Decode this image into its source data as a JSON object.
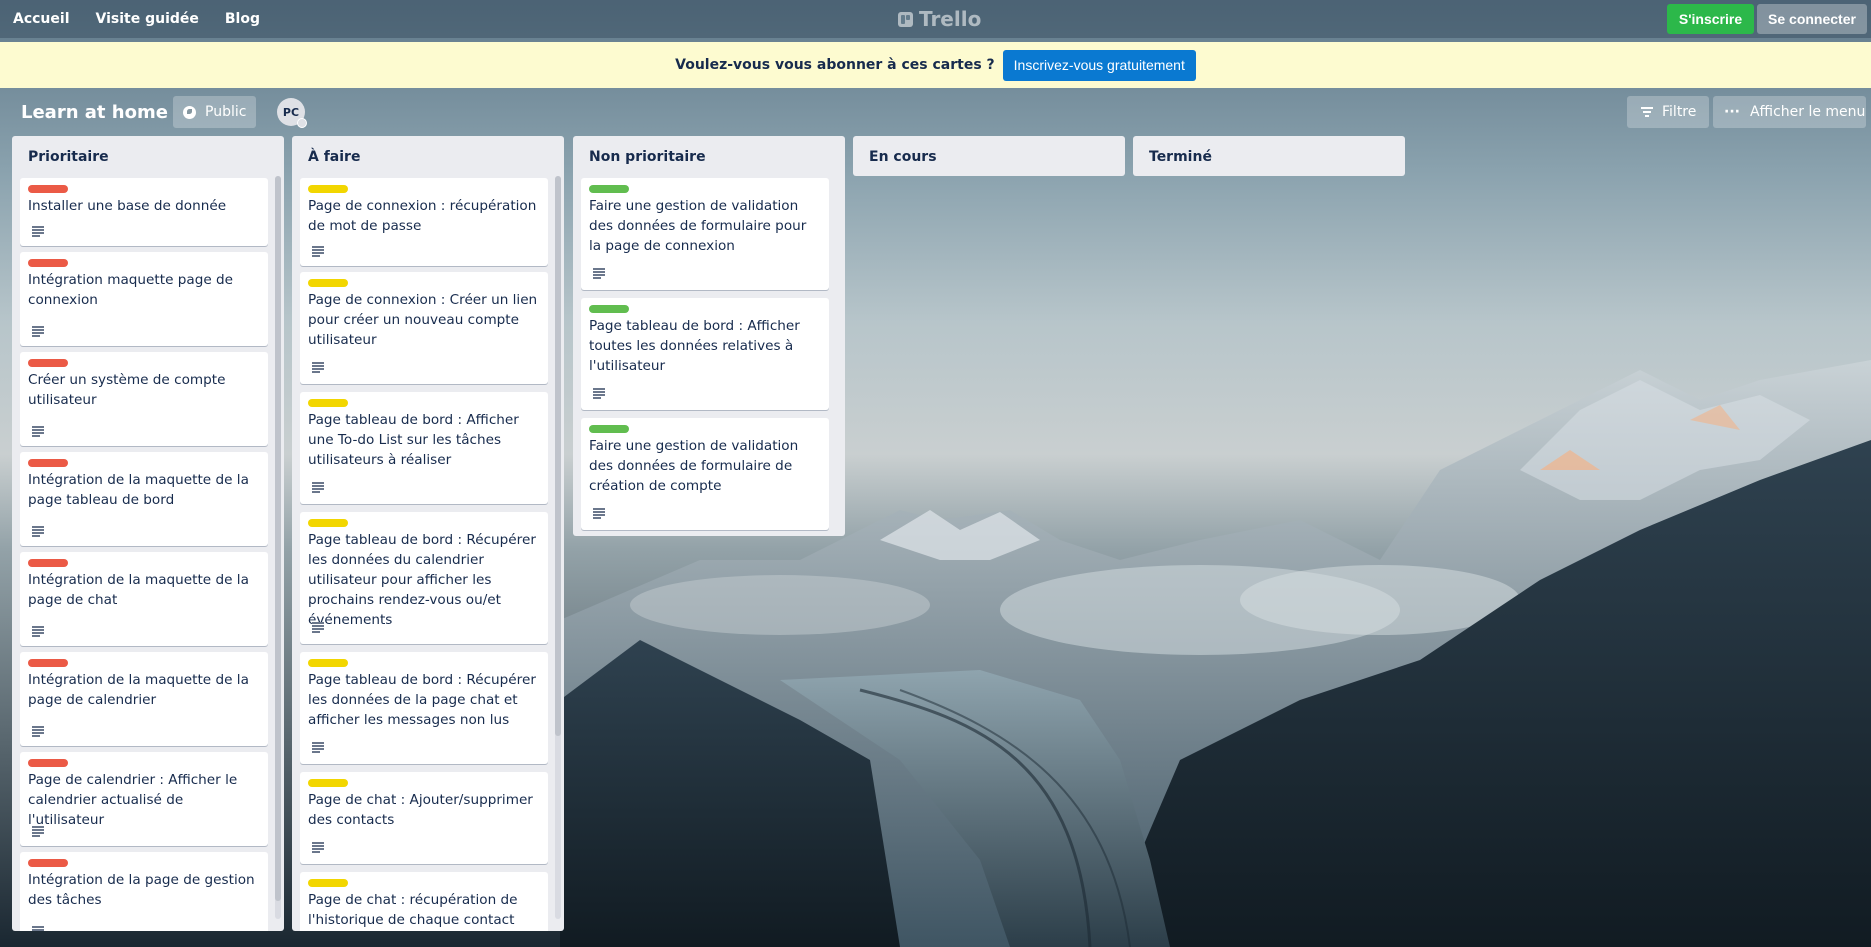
{
  "topbar": {
    "nav": [
      "Accueil",
      "Visite guidée",
      "Blog"
    ],
    "logo": "Trello",
    "signup_label": "S'inscrire",
    "login_label": "Se connecter"
  },
  "banner": {
    "text": "Voulez-vous vous abonner à ces cartes ?",
    "button": "Inscrivez-vous gratuitement"
  },
  "board": {
    "title": "Learn at home",
    "visibility": "Public",
    "avatar_initials": "PC",
    "filter_label": "Filtre",
    "menu_label": "Afficher le menu"
  },
  "colors": {
    "red_label": "#eb5a46",
    "yellow_label": "#f2d600",
    "green_label": "#61bd4f",
    "signup_green": "#2cb84a",
    "banner_bg": "#fdfbd0",
    "banner_button": "#0a79d1"
  },
  "lists": [
    {
      "title": "Prioritaire",
      "label_color": "red",
      "cards": [
        "Installer une base de donnée",
        "Intégration maquette page de connexion",
        "Créer un système de compte utilisateur",
        "Intégration de la maquette de la page tableau de bord",
        "Intégration de la maquette de la page de chat",
        "Intégration de la maquette de la page de calendrier",
        "Page de calendrier : Afficher le calendrier actualisé de l'utilisateur",
        "Intégration de la page de gestion des tâches"
      ]
    },
    {
      "title": "À faire",
      "label_color": "yellow",
      "cards": [
        "Page de connexion : récupération de mot de passe",
        "Page de connexion : Créer un lien pour créer un nouveau compte utilisateur",
        "Page tableau de bord : Afficher une To-do List sur les tâches utilisateurs à réaliser",
        "Page tableau de bord : Récupérer les données du calendrier utilisateur pour afficher les prochains rendez-vous ou/et événements",
        "Page tableau de bord : Récupérer les données de la page chat et afficher les messages non lus",
        "Page de chat : Ajouter/supprimer des contacts",
        "Page de chat : récupération de l'historique de chaque contact"
      ]
    },
    {
      "title": "Non prioritaire",
      "label_color": "green",
      "cards": [
        "Faire une gestion de validation des données de formulaire pour la page de connexion",
        "Page tableau de bord : Afficher toutes les données relatives à l'utilisateur",
        "Faire une gestion de validation des données de formulaire de création de compte"
      ]
    },
    {
      "title": "En cours",
      "cards": []
    },
    {
      "title": "Terminé",
      "cards": []
    }
  ]
}
